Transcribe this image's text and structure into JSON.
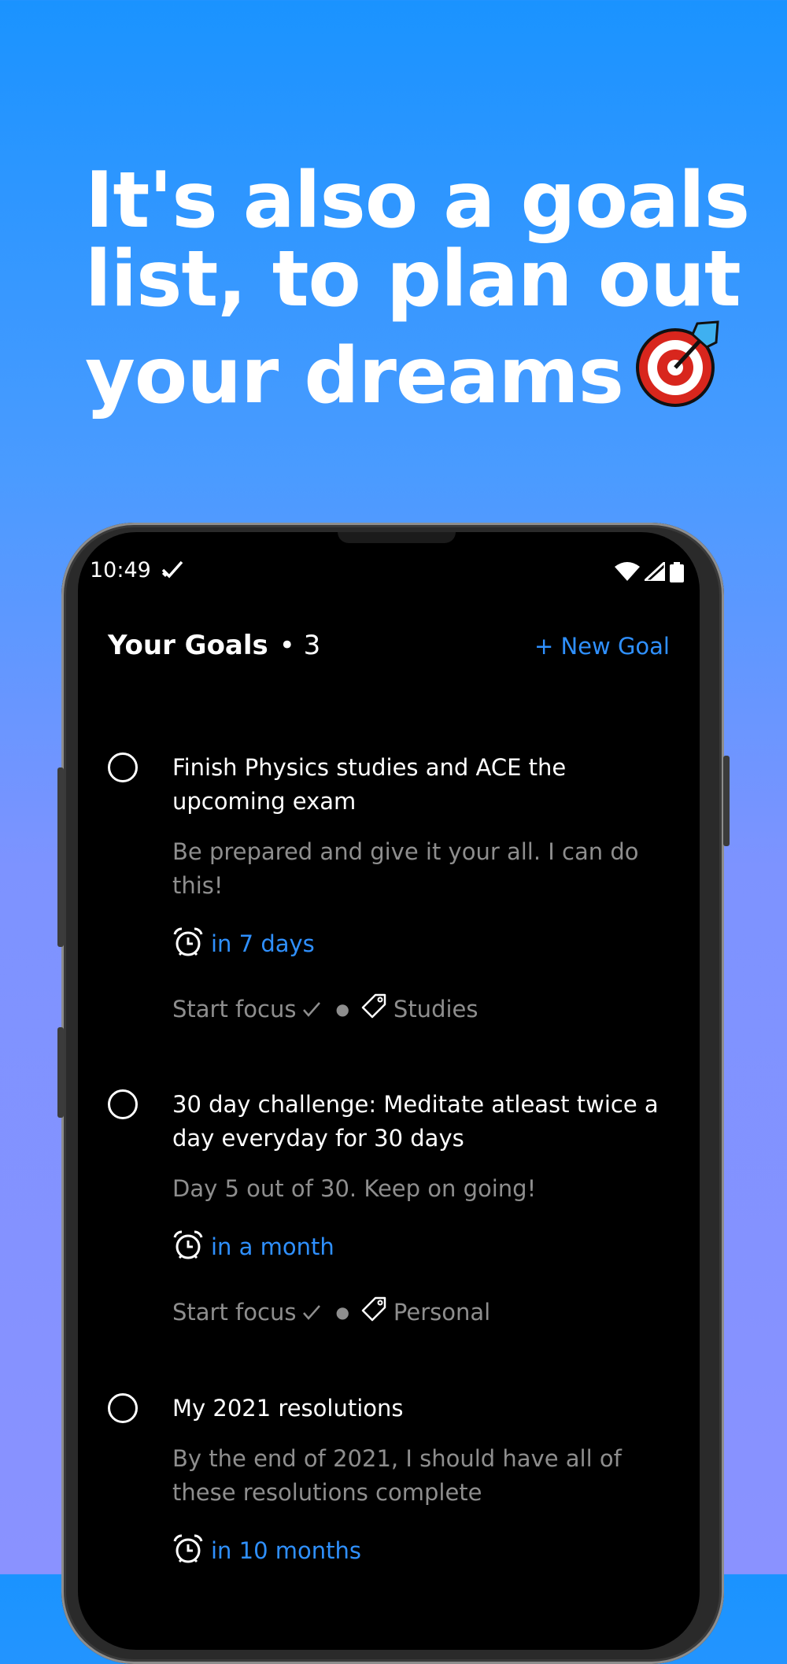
{
  "headline": {
    "line1": "It's also a goals",
    "line2": "list, to plan out",
    "line3": "your dreams",
    "emoji": "direct-hit-target-icon"
  },
  "status_bar": {
    "time": "10:49",
    "icons": [
      "check-icon",
      "wifi-icon",
      "signal-icon",
      "battery-icon"
    ]
  },
  "header": {
    "title": "Your Goals",
    "count": "• 3",
    "new_goal_label": "+ New Goal"
  },
  "goals": [
    {
      "title": "Finish Physics studies and ACE the upcoming exam",
      "description": "Be prepared and give it your all. I can do this!",
      "due": "in 7 days",
      "start_focus": "Start focus",
      "tag": "Studies"
    },
    {
      "title": "30 day challenge: Meditate atleast twice a day everyday for 30 days",
      "description": "Day 5 out of 30. Keep on going!",
      "due": "in a month",
      "start_focus": "Start focus",
      "tag": "Personal"
    },
    {
      "title": "My 2021 resolutions",
      "description": "By the end of 2021, I should have all of these resolutions complete",
      "due": "in 10 months"
    }
  ],
  "colors": {
    "accent": "#2f90ff",
    "background_top": "#1a93ff",
    "background_bottom": "#8a92ff",
    "screen": "#000000",
    "muted_text": "#8e8e8e"
  }
}
